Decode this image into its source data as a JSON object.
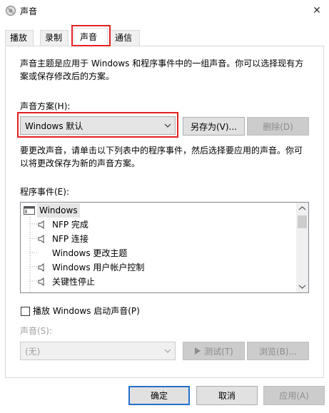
{
  "window": {
    "title": "声音",
    "close_glyph": "✕"
  },
  "tabs": [
    {
      "label": "播放",
      "active": false
    },
    {
      "label": "录制",
      "active": false
    },
    {
      "label": "声音",
      "active": true
    },
    {
      "label": "通信",
      "active": false
    }
  ],
  "description": {
    "line1": "声音主题是应用于 Windows 和程序事件中的一组声音。你可以选择现有方",
    "line2": "案或保存修改后的方案。"
  },
  "scheme": {
    "label": "声音方案(H):",
    "selected": "Windows 默认",
    "save_as_button": "另存为(V)...",
    "delete_button": "删除(D)"
  },
  "instructions": {
    "line1": "要更改声音，请单击以下列表中的程序事件，然后选择要应用的声音。你可",
    "line2": "以将更改保存为新的声音方案。"
  },
  "events": {
    "label": "程序事件(E):",
    "items": [
      {
        "label": "Windows",
        "type": "group",
        "icon": "window-icon",
        "selected": true
      },
      {
        "label": "NFP 完成",
        "type": "event",
        "icon": "speaker-icon"
      },
      {
        "label": "NFP 连接",
        "type": "event",
        "icon": "speaker-icon"
      },
      {
        "label": "Windows 更改主题",
        "type": "event",
        "icon": ""
      },
      {
        "label": "Windows 用户帐户控制",
        "type": "event",
        "icon": "speaker-icon"
      },
      {
        "label": "关键性停止",
        "type": "event",
        "icon": "speaker-icon"
      }
    ]
  },
  "startup": {
    "label": "播放 Windows 启动声音(P)",
    "checked": false
  },
  "sound": {
    "label": "声音(S):",
    "selected": "(无)",
    "test_button": "测试(T)",
    "browse_button": "浏览(B)..."
  },
  "footer": {
    "ok": "确定",
    "cancel": "取消",
    "apply": "应用(A)"
  },
  "colors": {
    "highlight_red": "#e32020",
    "focus_blue": "#2470cc",
    "disabled_gray": "#a0a0a0"
  }
}
